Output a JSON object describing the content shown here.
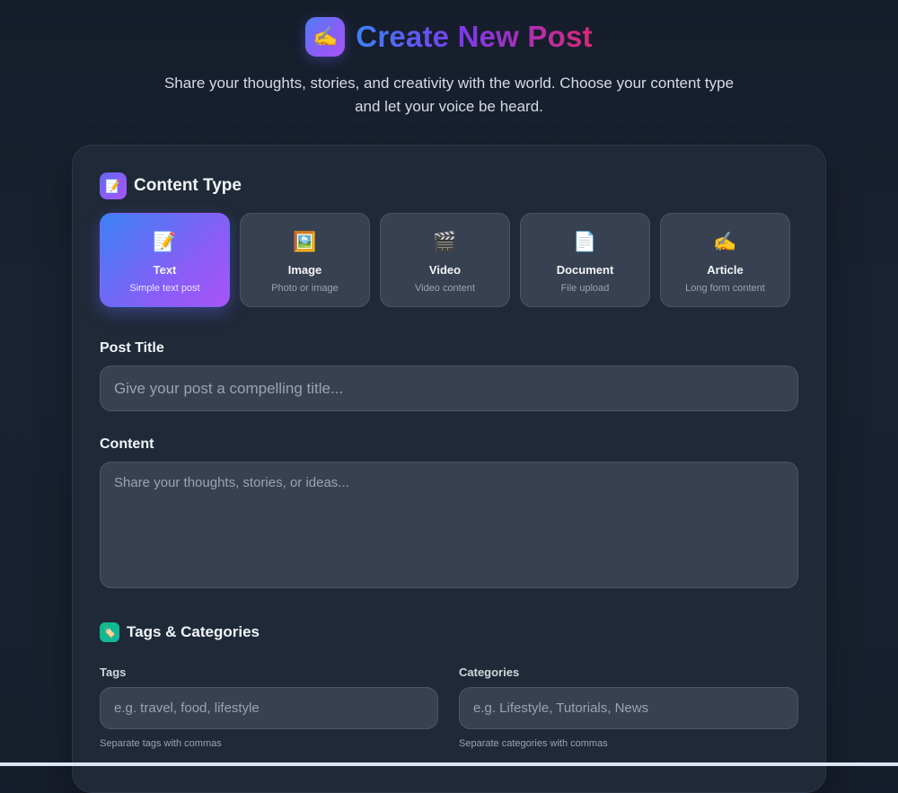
{
  "header": {
    "logo_icon": "writing-hand-icon",
    "logo_glyph": "✍️",
    "title": "Create New Post",
    "subtitle": "Share your thoughts, stories, and creativity with the world. Choose your content type and let your voice be heard."
  },
  "content_type": {
    "icon": "memo-icon",
    "icon_glyph": "📝",
    "heading": "Content Type",
    "selected": "Text",
    "options": [
      {
        "icon": "memo-icon",
        "glyph": "📝",
        "label": "Text",
        "sub": "Simple text post"
      },
      {
        "icon": "framed-picture-icon",
        "glyph": "🖼️",
        "label": "Image",
        "sub": "Photo or image"
      },
      {
        "icon": "clapper-board-icon",
        "glyph": "🎬",
        "label": "Video",
        "sub": "Video content"
      },
      {
        "icon": "page-icon",
        "glyph": "📄",
        "label": "Document",
        "sub": "File upload"
      },
      {
        "icon": "writing-hand-icon",
        "glyph": "✍️",
        "label": "Article",
        "sub": "Long form content"
      }
    ]
  },
  "post_title": {
    "label": "Post Title",
    "value": "",
    "placeholder": "Give your post a compelling title..."
  },
  "content": {
    "label": "Content",
    "value": "",
    "placeholder": "Share your thoughts, stories, or ideas..."
  },
  "tags_section": {
    "icon": "label-tag-icon",
    "icon_glyph": "🏷️",
    "heading": "Tags & Categories",
    "tags": {
      "label": "Tags",
      "value": "",
      "placeholder": "e.g. travel, food, lifestyle",
      "hint": "Separate tags with commas"
    },
    "categories": {
      "label": "Categories",
      "value": "",
      "placeholder": "e.g. Lifestyle, Tutorials, News",
      "hint": "Separate categories with commas"
    }
  },
  "colors": {
    "background": "#1a2232",
    "card": "#1f2937",
    "input": "#374151",
    "accent_start": "#3b82f6",
    "accent_end": "#a855f7",
    "title_gradient_end": "#db2777",
    "tag_icon": "#10b981"
  }
}
